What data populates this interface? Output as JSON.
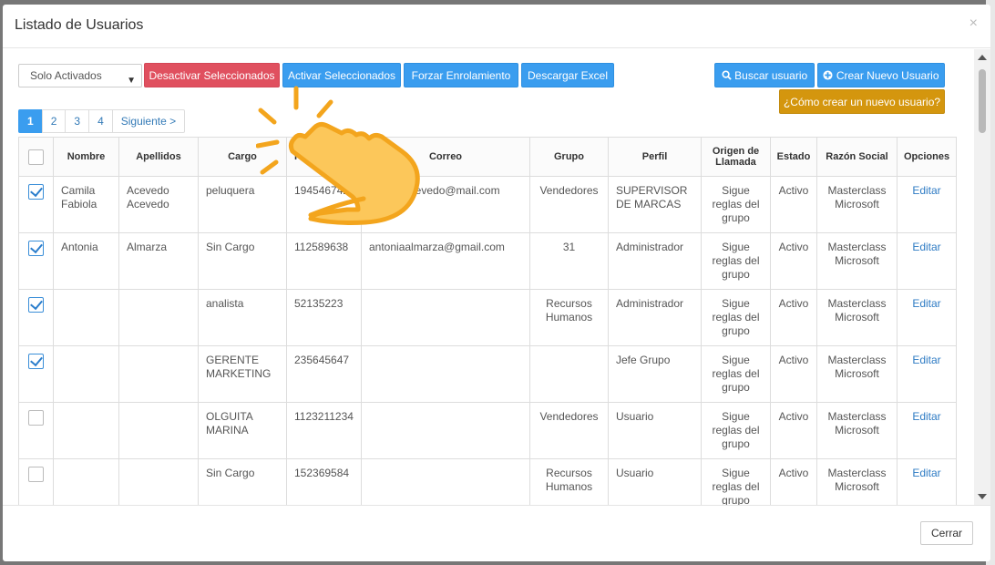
{
  "modal": {
    "title": "Listado de Usuarios",
    "close_symbol": "×"
  },
  "toolbar": {
    "filter_select": "Solo Activados",
    "deactivate_label": "Desactivar Seleccionados",
    "activate_label": "Activar Seleccionados",
    "force_enroll_label": "Forzar Enrolamiento",
    "download_excel_label": "Descargar Excel",
    "search_user_label": "Buscar usuario",
    "create_user_label": "Crear Nuevo Usuario",
    "help_label": "¿Cómo crear un nuevo usuario?"
  },
  "pagination": {
    "pages": [
      "1",
      "2",
      "3",
      "4"
    ],
    "active": "1",
    "next_label": "Siguiente >"
  },
  "table": {
    "headers": {
      "nombre": "Nombre",
      "apellidos": "Apellidos",
      "cargo": "Cargo",
      "id": "I",
      "correo": "Correo",
      "grupo": "Grupo",
      "perfil": "Perfil",
      "origen": "Origen de Llamada",
      "estado": "Estado",
      "razon": "Razón Social",
      "opciones": "Opciones"
    },
    "rows": [
      {
        "checked": true,
        "nombre": "Camila Fabiola",
        "apellidos": "Acevedo Acevedo",
        "cargo": "peluquera",
        "id": "194546742",
        "correo": "camila.acevedo@mail.com",
        "grupo": "Vendedores",
        "perfil": "SUPERVISOR DE MARCAS",
        "origen": "Sigue reglas del grupo",
        "estado": "Activo",
        "razon": "Masterclass Microsoft",
        "accion": "Editar"
      },
      {
        "checked": true,
        "nombre": "Antonia",
        "apellidos": "Almarza",
        "cargo": "Sin Cargo",
        "id": "112589638",
        "correo": "antoniaalmarza@gmail.com",
        "grupo": "31",
        "perfil": "Administrador",
        "origen": "Sigue reglas del grupo",
        "estado": "Activo",
        "razon": "Masterclass Microsoft",
        "accion": "Editar"
      },
      {
        "checked": true,
        "nombre": "",
        "apellidos": "",
        "cargo": "analista",
        "id": "52135223",
        "correo": "",
        "grupo": "Recursos Humanos",
        "perfil": "Administrador",
        "origen": "Sigue reglas del grupo",
        "estado": "Activo",
        "razon": "Masterclass Microsoft",
        "accion": "Editar"
      },
      {
        "checked": true,
        "nombre": "",
        "apellidos": "",
        "cargo": "GERENTE MARKETING",
        "id": "235645647",
        "correo": "",
        "grupo": "",
        "perfil": "Jefe Grupo",
        "origen": "Sigue reglas del grupo",
        "estado": "Activo",
        "razon": "Masterclass Microsoft",
        "accion": "Editar"
      },
      {
        "checked": false,
        "nombre": "",
        "apellidos": "",
        "cargo": "OLGUITA MARINA",
        "id": "1123211234",
        "correo": "",
        "grupo": "Vendedores",
        "perfil": "Usuario",
        "origen": "Sigue reglas del grupo",
        "estado": "Activo",
        "razon": "Masterclass Microsoft",
        "accion": "Editar"
      },
      {
        "checked": false,
        "nombre": "",
        "apellidos": "",
        "cargo": "Sin Cargo",
        "id": "152369584",
        "correo": "",
        "grupo": "Recursos Humanos",
        "perfil": "Usuario",
        "origen": "Sigue reglas del grupo",
        "estado": "Activo",
        "razon": "Masterclass Microsoft",
        "accion": "Editar"
      }
    ]
  },
  "footer": {
    "close_label": "Cerrar"
  },
  "colors": {
    "red": "#e0505f",
    "blue": "#3a9def",
    "gold": "#d4960e",
    "hand": "#fcc75a",
    "hand_outline": "#f3a51d"
  },
  "icons": [
    "search-icon",
    "plus-circle-icon",
    "pointing-hand-icon",
    "chevron-down-icon",
    "close-icon"
  ]
}
